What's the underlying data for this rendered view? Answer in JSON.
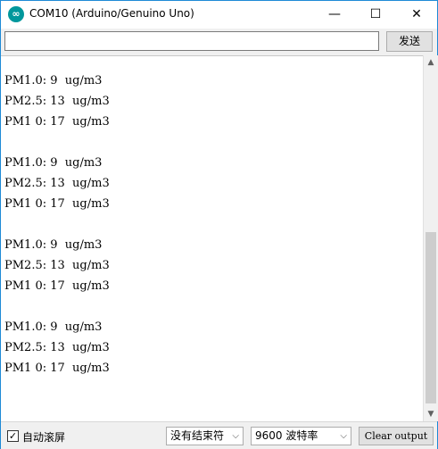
{
  "window": {
    "title": "COM10 (Arduino/Genuino Uno)",
    "app_icon": "arduino-logo-icon"
  },
  "window_controls": {
    "minimize": "—",
    "maximize": "☐",
    "close": "✕"
  },
  "input": {
    "value": "",
    "send_label": "发送"
  },
  "output": {
    "lines": [
      "PM1.0: 9  ug/m3",
      "PM2.5: 13  ug/m3",
      "PM1 0: 17  ug/m3",
      "",
      "PM1.0: 9  ug/m3",
      "PM2.5: 13  ug/m3",
      "PM1 0: 17  ug/m3",
      "",
      "PM1.0: 9  ug/m3",
      "PM2.5: 13  ug/m3",
      "PM1 0: 17  ug/m3",
      "",
      "PM1.0: 9  ug/m3",
      "PM2.5: 13  ug/m3",
      "PM1 0: 17  ug/m3"
    ]
  },
  "scrollbar": {
    "up": "▲",
    "down": "▼"
  },
  "status": {
    "autoscroll_label": "自动滚屏",
    "autoscroll_checked": true,
    "line_ending": "没有结束符",
    "baud_rate": "9600 波特率",
    "clear_label": "Clear output",
    "chevron": "⌵"
  }
}
